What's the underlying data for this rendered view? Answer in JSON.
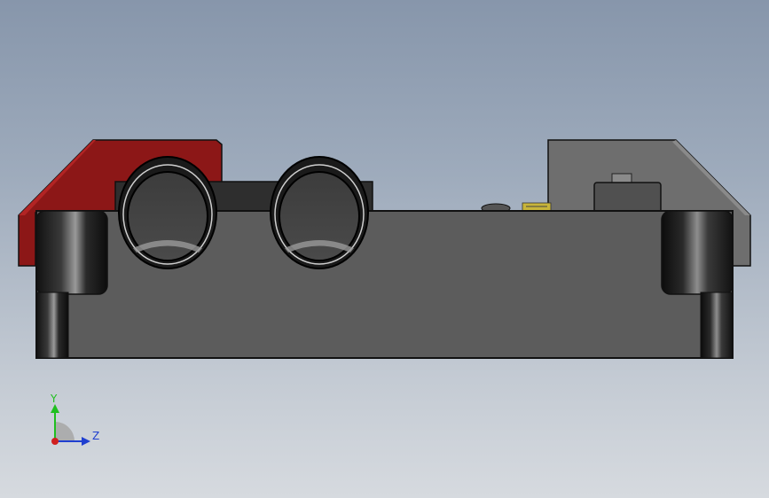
{
  "viewport": {
    "background_top": "#8796ab",
    "background_bottom": "#d6dadf"
  },
  "model": {
    "body_color": "#5c5c5c",
    "left_cap_color": "#8c1717",
    "right_cap_color": "#6e6e6e",
    "label_color": "#c8b53a"
  },
  "triad": {
    "y_label": "Y",
    "z_label": "Z",
    "y_color": "#1fbf1f",
    "z_color": "#1f3fd0",
    "x_color": "#d01f1f"
  }
}
